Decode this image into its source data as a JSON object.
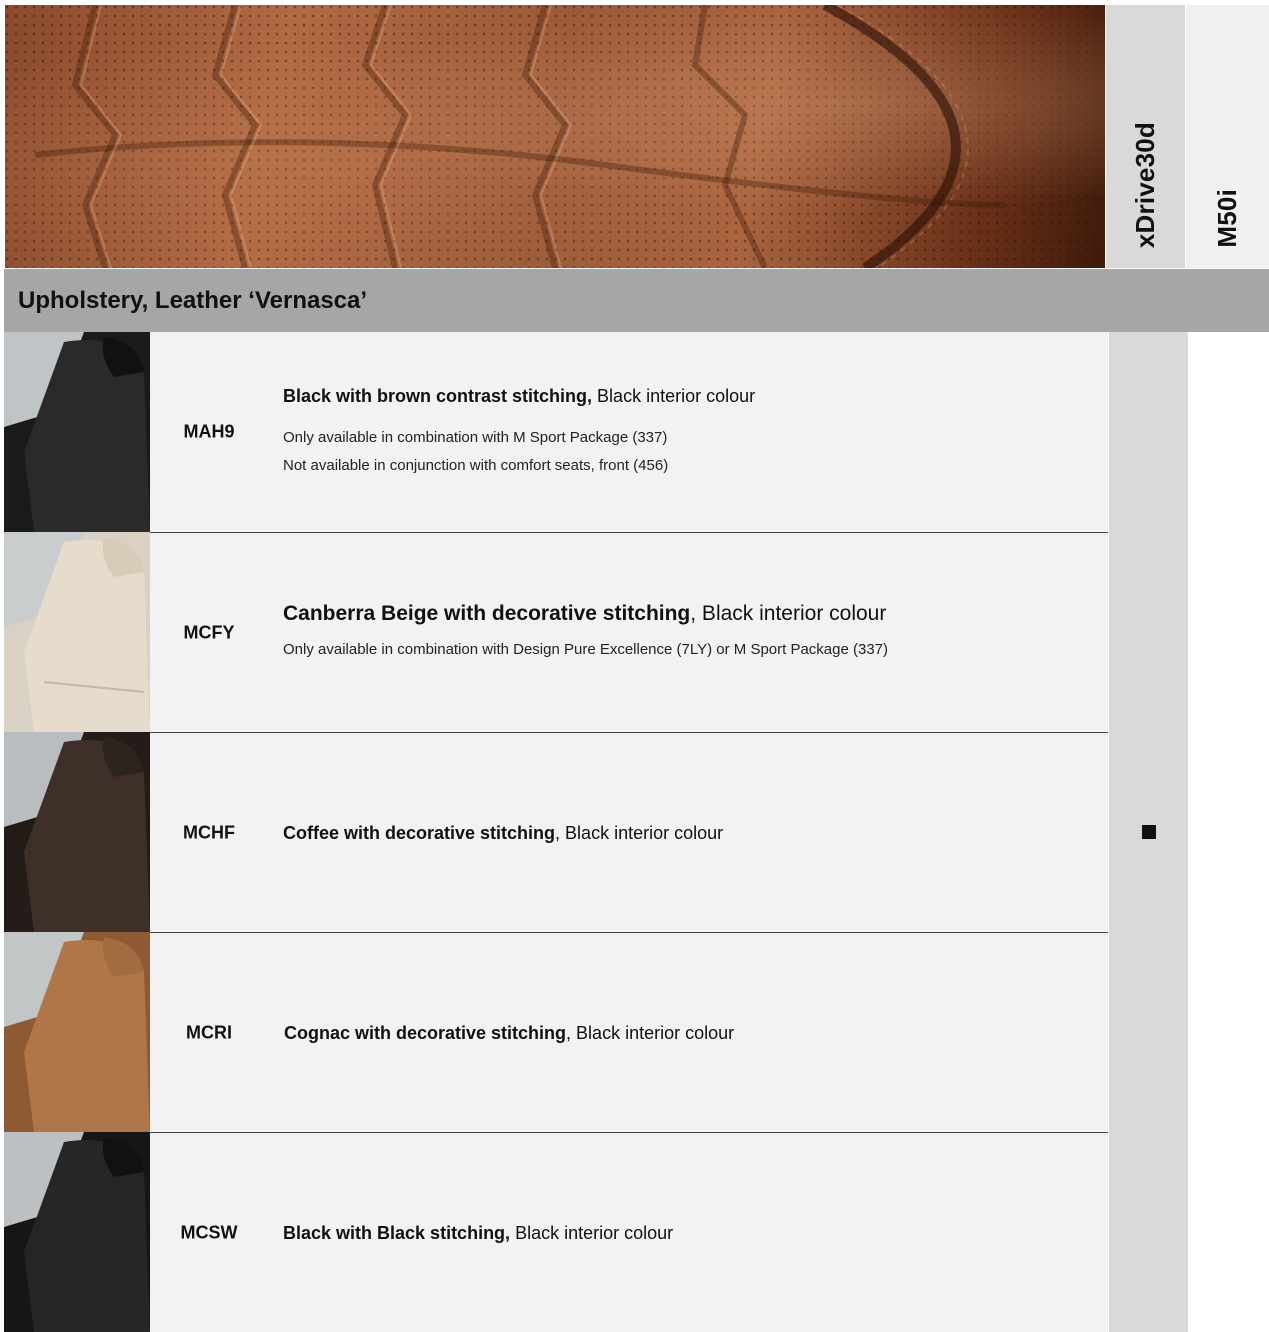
{
  "header": {
    "columns": [
      {
        "label": "xDrive30d"
      },
      {
        "label": "M50i"
      }
    ]
  },
  "section": {
    "title": "Upholstery, Leather ‘Vernasca’"
  },
  "rows": [
    {
      "code": "MAH9",
      "title_bold": "Black with brown contrast stitching,",
      "title_rest": " Black interior colour",
      "notes": [
        "Only available in combination with M Sport Package (337)",
        "Not available in conjunction with comfort seats, front (456)"
      ],
      "seat_color": "#2a2a2a"
    },
    {
      "code": "MCFY",
      "title_bold": "Canberra Beige with decorative stitching",
      "title_rest": ", Black interior colour",
      "notes": [
        "Only available in combination with Design Pure Excellence (7LY) or  M Sport Package (337)"
      ],
      "seat_color": "#e6dccb"
    },
    {
      "code": "MCHF",
      "title_bold": "Coffee with decorative stitching",
      "title_rest": ", Black interior colour",
      "notes": [],
      "seat_color": "#3e3029",
      "standard_marker": "■"
    },
    {
      "code": "MCRI",
      "title_bold": "Cognac with decorative stitching",
      "title_rest": ", Black interior colour",
      "notes": [],
      "seat_color": "#b07647"
    },
    {
      "code": "MCSW",
      "title_bold": "Black with Black stitching,",
      "title_rest": " Black interior colour",
      "notes": [],
      "seat_color": "#262626"
    }
  ]
}
